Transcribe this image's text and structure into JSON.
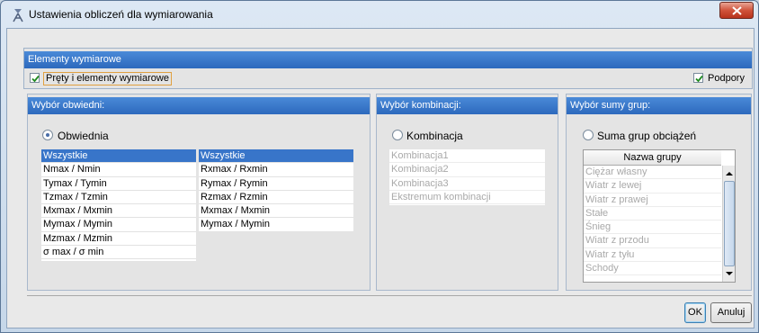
{
  "window": {
    "title": "Ustawienia obliczeń dla wymiarowania"
  },
  "elements": {
    "header": "Elementy wymiarowe",
    "bars_checkbox_label": "Pręty i elementy wymiarowe",
    "supports_checkbox_label": "Podpory"
  },
  "envelope": {
    "header": "Wybór obwiedni:",
    "radio_label": "Obwiednia",
    "list1": [
      "Wszystkie",
      "Nmax / Nmin",
      "Tymax / Tymin",
      "Tzmax / Tzmin",
      "Mxmax / Mxmin",
      "Mymax / Mymin",
      "Mzmax / Mzmin",
      "σ max / σ min"
    ],
    "list2": [
      "Wszystkie",
      "Rxmax / Rxmin",
      "Rymax / Rymin",
      "Rzmax / Rzmin",
      "Mxmax / Mxmin",
      "Mymax / Mymin"
    ]
  },
  "combination": {
    "header": "Wybór kombinacji:",
    "radio_label": "Kombinacja",
    "items": [
      "Kombinacja1",
      "Kombinacja2",
      "Kombinacja3",
      "Ekstremum kombinacji"
    ]
  },
  "groups": {
    "header": "Wybór sumy grup:",
    "radio_label": "Suma grup obciążeń",
    "column_header": "Nazwa grupy",
    "items": [
      "Ciężar własny",
      "Wiatr z lewej",
      "Wiatr z prawej",
      "Stałe",
      "Śnieg",
      "Wiatr z przodu",
      "Wiatr z tyłu",
      "Schody"
    ]
  },
  "buttons": {
    "ok": "OK",
    "cancel": "Anuluj"
  },
  "colors": {
    "header_blue": "#3a7ad0",
    "selection_blue": "#3875c9",
    "close_red": "#c8432c"
  }
}
